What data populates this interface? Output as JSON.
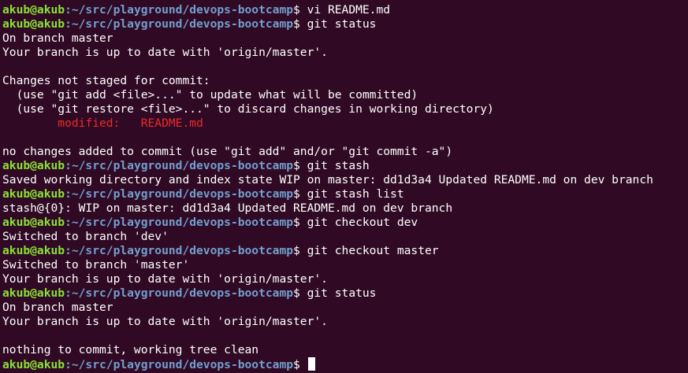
{
  "colors": {
    "background": "#300a24",
    "user_host": "#8ae234",
    "path": "#729fcf",
    "text": "#ffffff",
    "modified": "#ef2929"
  },
  "lines": [
    {
      "type": "prompt",
      "user": "akub@akub",
      "path": ":~/src/playground/devops-bootcamp",
      "sym": "$ ",
      "cmd": "vi README.md"
    },
    {
      "type": "prompt",
      "user": "akub@akub",
      "path": ":~/src/playground/devops-bootcamp",
      "sym": "$ ",
      "cmd": "git status"
    },
    {
      "type": "output",
      "text": "On branch master"
    },
    {
      "type": "output",
      "text": "Your branch is up to date with 'origin/master'."
    },
    {
      "type": "output",
      "text": ""
    },
    {
      "type": "output",
      "text": "Changes not staged for commit:"
    },
    {
      "type": "output",
      "text": "  (use \"git add <file>...\" to update what will be committed)"
    },
    {
      "type": "output",
      "text": "  (use \"git restore <file>...\" to discard changes in working directory)"
    },
    {
      "type": "modified",
      "text": "\tmodified:   README.md"
    },
    {
      "type": "output",
      "text": ""
    },
    {
      "type": "output",
      "text": "no changes added to commit (use \"git add\" and/or \"git commit -a\")"
    },
    {
      "type": "prompt",
      "user": "akub@akub",
      "path": ":~/src/playground/devops-bootcamp",
      "sym": "$ ",
      "cmd": "git stash"
    },
    {
      "type": "output",
      "text": "Saved working directory and index state WIP on master: dd1d3a4 Updated README.md on dev branch"
    },
    {
      "type": "prompt",
      "user": "akub@akub",
      "path": ":~/src/playground/devops-bootcamp",
      "sym": "$ ",
      "cmd": "git stash list"
    },
    {
      "type": "output",
      "text": "stash@{0}: WIP on master: dd1d3a4 Updated README.md on dev branch"
    },
    {
      "type": "prompt",
      "user": "akub@akub",
      "path": ":~/src/playground/devops-bootcamp",
      "sym": "$ ",
      "cmd": "git checkout dev"
    },
    {
      "type": "output",
      "text": "Switched to branch 'dev'"
    },
    {
      "type": "prompt",
      "user": "akub@akub",
      "path": ":~/src/playground/devops-bootcamp",
      "sym": "$ ",
      "cmd": "git checkout master"
    },
    {
      "type": "output",
      "text": "Switched to branch 'master'"
    },
    {
      "type": "output",
      "text": "Your branch is up to date with 'origin/master'."
    },
    {
      "type": "prompt",
      "user": "akub@akub",
      "path": ":~/src/playground/devops-bootcamp",
      "sym": "$ ",
      "cmd": "git status"
    },
    {
      "type": "output",
      "text": "On branch master"
    },
    {
      "type": "output",
      "text": "Your branch is up to date with 'origin/master'."
    },
    {
      "type": "output",
      "text": ""
    },
    {
      "type": "output",
      "text": "nothing to commit, working tree clean"
    },
    {
      "type": "current_prompt",
      "user": "akub@akub",
      "path": ":~/src/playground/devops-bootcamp",
      "sym": "$ ",
      "cmd": ""
    }
  ]
}
